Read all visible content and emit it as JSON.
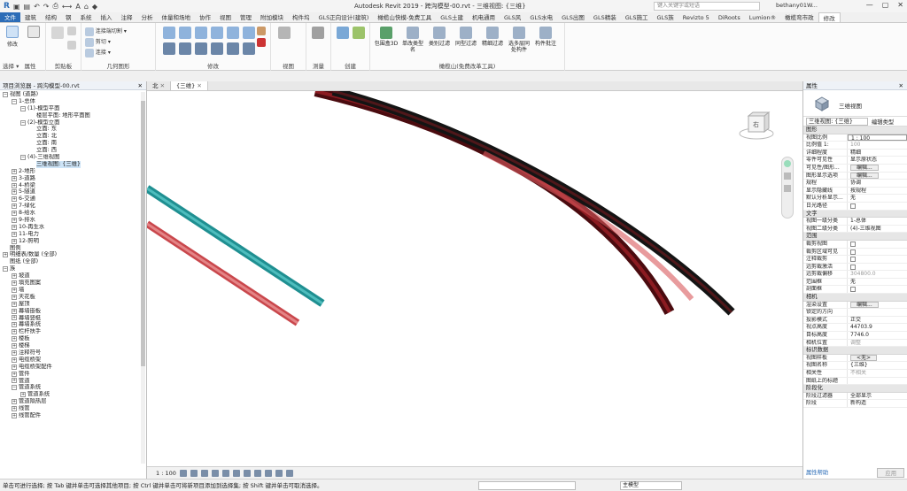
{
  "app_title": "Autodesk Revit 2019 -  跨沟模型-00.rvt - 三维视图: {三维}",
  "search_placeholder": "键入关键字或短语",
  "user_name": "bethany01W...",
  "tabs": [
    "文件",
    "建筑",
    "结构",
    "钢",
    "系统",
    "插入",
    "注释",
    "分析",
    "体量和场地",
    "协作",
    "视图",
    "管理",
    "附加模块",
    "构件坞",
    "GLS正向设计(建筑)",
    "橄榄山快模-免费工具",
    "GLS土建",
    "机电通用",
    "GLS风",
    "GLS水电",
    "GLS出图",
    "GLS精装",
    "GLS施工",
    "GLS族",
    "Revizto 5",
    "DiRoots",
    "Lumion®",
    "橄榄弯市政",
    "修改"
  ],
  "active_tab_index": 28,
  "ribbon": {
    "modify": "修改",
    "select": "选择 ▾",
    "properties": "属性",
    "clipboard": "剪贴板",
    "geometry": "几何图形",
    "geo_items": [
      "连接端切割 ▾",
      "剪切 ▾",
      "连接 ▾"
    ],
    "modify_group": "修改",
    "view": "视图",
    "measure": "测量",
    "create": "创建",
    "olive": {
      "label": "橄榄山(免费改革工具)",
      "buttons": [
        "包围盒3D",
        "单改类型名",
        "类别过滤",
        "同型过滤",
        "精细过滤",
        "选多层同处构件",
        "构件批注"
      ]
    }
  },
  "project_browser": {
    "title": "项目浏览器 - 跨沟模型-00.rvt",
    "nodes": [
      {
        "level": 0,
        "exp": "−",
        "text": "视图 (道路)"
      },
      {
        "level": 1,
        "exp": "−",
        "text": "1-总体"
      },
      {
        "level": 2,
        "exp": "−",
        "text": "(1)-模型平面"
      },
      {
        "level": 3,
        "exp": "",
        "text": "楼层平面: 地形平面图"
      },
      {
        "level": 2,
        "exp": "−",
        "text": "(2)-模型立面"
      },
      {
        "level": 3,
        "exp": "",
        "text": "立面: 东"
      },
      {
        "level": 3,
        "exp": "",
        "text": "立面: 北"
      },
      {
        "level": 3,
        "exp": "",
        "text": "立面: 南"
      },
      {
        "level": 3,
        "exp": "",
        "text": "立面: 西"
      },
      {
        "level": 2,
        "exp": "−",
        "text": "(4)-三维视图"
      },
      {
        "level": 3,
        "exp": "",
        "text": "三维视图: {三维}",
        "selected": true
      },
      {
        "level": 1,
        "exp": "+",
        "text": "2-地形"
      },
      {
        "level": 1,
        "exp": "+",
        "text": "3-道路"
      },
      {
        "level": 1,
        "exp": "+",
        "text": "4-桥梁"
      },
      {
        "level": 1,
        "exp": "+",
        "text": "5-隧道"
      },
      {
        "level": 1,
        "exp": "+",
        "text": "6-交通"
      },
      {
        "level": 1,
        "exp": "+",
        "text": "7-绿化"
      },
      {
        "level": 1,
        "exp": "+",
        "text": "8-给水"
      },
      {
        "level": 1,
        "exp": "+",
        "text": "9-排水"
      },
      {
        "level": 1,
        "exp": "+",
        "text": "10-再生水"
      },
      {
        "level": 1,
        "exp": "+",
        "text": "11-电力"
      },
      {
        "level": 1,
        "exp": "+",
        "text": "12-照明"
      },
      {
        "level": 0,
        "exp": "",
        "text": "图例"
      },
      {
        "level": 0,
        "exp": "+",
        "text": "明细表/数量 (全部)"
      },
      {
        "level": 0,
        "exp": "",
        "text": "图纸 (全部)"
      },
      {
        "level": 0,
        "exp": "−",
        "text": "族"
      },
      {
        "level": 1,
        "exp": "+",
        "text": "坡道"
      },
      {
        "level": 1,
        "exp": "+",
        "text": "填充图案"
      },
      {
        "level": 1,
        "exp": "+",
        "text": "墙"
      },
      {
        "level": 1,
        "exp": "+",
        "text": "天花板"
      },
      {
        "level": 1,
        "exp": "+",
        "text": "屋顶"
      },
      {
        "level": 1,
        "exp": "+",
        "text": "幕墙嵌板"
      },
      {
        "level": 1,
        "exp": "+",
        "text": "幕墙竖梃"
      },
      {
        "level": 1,
        "exp": "+",
        "text": "幕墙系统"
      },
      {
        "level": 1,
        "exp": "+",
        "text": "栏杆扶手"
      },
      {
        "level": 1,
        "exp": "+",
        "text": "楼板"
      },
      {
        "level": 1,
        "exp": "+",
        "text": "楼梯"
      },
      {
        "level": 1,
        "exp": "+",
        "text": "注释符号"
      },
      {
        "level": 1,
        "exp": "+",
        "text": "电缆桥架"
      },
      {
        "level": 1,
        "exp": "+",
        "text": "电缆桥架配件"
      },
      {
        "level": 1,
        "exp": "+",
        "text": "管件"
      },
      {
        "level": 1,
        "exp": "+",
        "text": "管道"
      },
      {
        "level": 1,
        "exp": "−",
        "text": "管道系统"
      },
      {
        "level": 2,
        "exp": "+",
        "text": "管道系统"
      },
      {
        "level": 1,
        "exp": "+",
        "text": "管道隔热层"
      },
      {
        "level": 1,
        "exp": "+",
        "text": "线管"
      },
      {
        "level": 1,
        "exp": "+",
        "text": "线管配件"
      }
    ]
  },
  "view_tabs": [
    {
      "label": "北",
      "active": false
    },
    {
      "label": "{三维}",
      "active": true
    }
  ],
  "navcube_face": "右",
  "viewbar_scale": "1 : 100",
  "properties": {
    "title": "属性",
    "type_name": "三维视图",
    "selector": "三维视图: {三维}",
    "edit_type": "编辑类型",
    "sections": [
      {
        "name": "图形",
        "rows": [
          {
            "k": "视图比例",
            "v": "1 : 100",
            "kind": "input"
          },
          {
            "k": "比例值 1:",
            "v": "100",
            "kind": "grey"
          },
          {
            "k": "详细程度",
            "v": "精细"
          },
          {
            "k": "零件可见性",
            "v": "显示原状态"
          },
          {
            "k": "可见性/图形...",
            "v": "编辑...",
            "kind": "btn"
          },
          {
            "k": "图形显示选项",
            "v": "编辑...",
            "kind": "btn"
          },
          {
            "k": "规程",
            "v": "协调"
          },
          {
            "k": "显示隐藏线",
            "v": "按规程"
          },
          {
            "k": "默认分析显示...",
            "v": "无"
          },
          {
            "k": "日光路径",
            "v": "",
            "kind": "chk"
          }
        ]
      },
      {
        "name": "文字",
        "rows": [
          {
            "k": "视图一级分类",
            "v": "1-总体"
          },
          {
            "k": "视图二级分类",
            "v": "(4)-三维视图"
          }
        ]
      },
      {
        "name": "范围",
        "rows": [
          {
            "k": "裁剪视图",
            "v": "",
            "kind": "chk"
          },
          {
            "k": "裁剪区域可见",
            "v": "",
            "kind": "chk"
          },
          {
            "k": "注释裁剪",
            "v": "",
            "kind": "chk"
          },
          {
            "k": "远剪裁激活",
            "v": "",
            "kind": "chk"
          },
          {
            "k": "远剪裁偏移",
            "v": "304800.0",
            "kind": "grey"
          },
          {
            "k": "范围框",
            "v": "无"
          },
          {
            "k": "剖面框",
            "v": "",
            "kind": "chk"
          }
        ]
      },
      {
        "name": "相机",
        "rows": [
          {
            "k": "渲染设置",
            "v": "编辑...",
            "kind": "btn"
          },
          {
            "k": "锁定的方向",
            "v": "",
            "kind": "grey"
          },
          {
            "k": "投影模式",
            "v": "正交"
          },
          {
            "k": "视点高度",
            "v": "44703.9"
          },
          {
            "k": "目标高度",
            "v": "7746.0"
          },
          {
            "k": "相机位置",
            "v": "调整",
            "kind": "grey"
          }
        ]
      },
      {
        "name": "标识数据",
        "rows": [
          {
            "k": "视图样板",
            "v": "<无>",
            "kind": "btn"
          },
          {
            "k": "视图名称",
            "v": "{三维}"
          },
          {
            "k": "相关性",
            "v": "不相关",
            "kind": "grey"
          },
          {
            "k": "图纸上的标题",
            "v": ""
          }
        ]
      },
      {
        "name": "阶段化",
        "rows": [
          {
            "k": "阶段过滤器",
            "v": "全部显示"
          },
          {
            "k": "阶段",
            "v": "新构造"
          }
        ]
      }
    ],
    "help": "属性帮助",
    "apply": "应用"
  },
  "status_text": "单击可进行选择; 按 Tab 键并单击可选择其他项目; 按 Ctrl 键并单击可将新项目添加到选择集; 按 Shift 键并单击可取消选择。",
  "status_model": "主模型",
  "colors": {
    "accent": "#2b6cb7",
    "cyan": "#2aa8a8",
    "red": "#d9585c",
    "black": "#1b1b1b"
  }
}
